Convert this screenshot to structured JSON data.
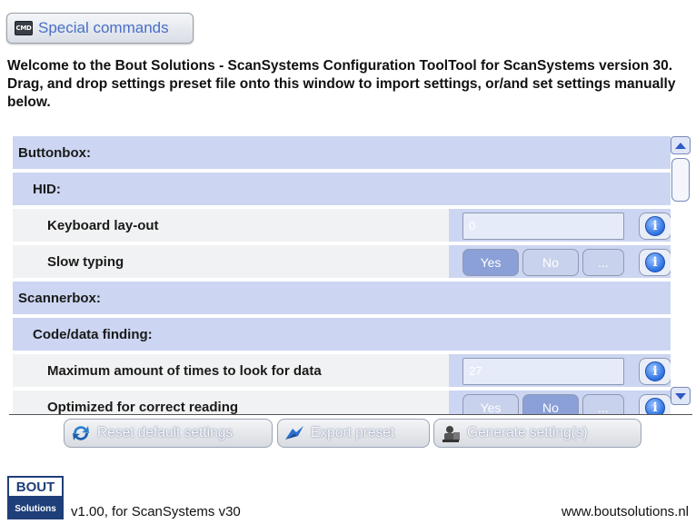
{
  "toolbar": {
    "special_commands_icon": "CMD",
    "special_commands_label": "Special commands"
  },
  "welcome_text": "Welcome to the Bout Solutions - ScanSystems Configuration ToolTool for ScanSystems version 30. Drag, and drop settings preset file onto this window to import settings, or/and set settings manually below.",
  "settings": {
    "buttonbox": "Buttonbox:",
    "hid": "HID:",
    "keyboard_layout": {
      "label": "Keyboard lay-out",
      "value": "0"
    },
    "slow_typing": {
      "label": "Slow typing",
      "selected": "Yes",
      "yes": "Yes",
      "no": "No",
      "more": "..."
    },
    "scannerbox": "Scannerbox:",
    "code_data_finding": "Code/data finding:",
    "max_times": {
      "label": "Maximum amount of times to look for data",
      "value": "27"
    },
    "partial_row": {
      "label": "Optimized for correct reading",
      "yes": "Yes",
      "no": "No",
      "more": "..."
    }
  },
  "actions": {
    "reset": "Reset default settings",
    "export": "Export preset",
    "generate": "Generate setting(s)"
  },
  "footer": {
    "logo_top": "BOUT",
    "logo_bottom": "Solutions",
    "version": "v1.00, for ScanSystems v30",
    "website": "www.boutsolutions.nl"
  },
  "colors": {
    "section_bg": "#ccd6f2",
    "setting_bg": "#f1f2f3",
    "accent": "#4a6fc6",
    "brand": "#1f3f7a"
  },
  "icons": [
    "cmd-icon",
    "info-icon",
    "reset-icon",
    "export-icon",
    "generate-icon",
    "scroll-up-icon",
    "scroll-down-icon"
  ]
}
